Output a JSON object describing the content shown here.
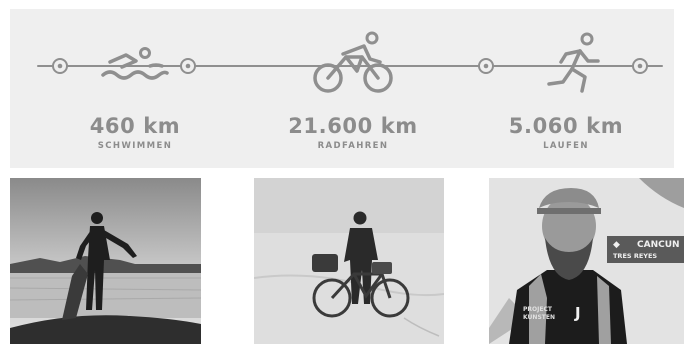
{
  "stats": [
    {
      "value": "460 km",
      "label": "SCHWIMMEN",
      "icon": "swimmer-icon"
    },
    {
      "value": "21.600 km",
      "label": "RADFAHREN",
      "icon": "cyclist-icon"
    },
    {
      "value": "5.060 km",
      "label": "LAUFEN",
      "icon": "runner-icon"
    }
  ],
  "photos": [
    {
      "subject": "swim"
    },
    {
      "subject": "bike"
    },
    {
      "subject": "run",
      "sign_text": "CANCUN",
      "sign_subtext": "TRES REYES",
      "shirt_text_1": "PROJECT",
      "shirt_text_2": "KUNSTEN",
      "shirt_logo": "J"
    }
  ],
  "colors": {
    "panel_bg": "#efefef",
    "icon_gray": "#8f8f8f",
    "text_gray": "#8c8c8c"
  }
}
